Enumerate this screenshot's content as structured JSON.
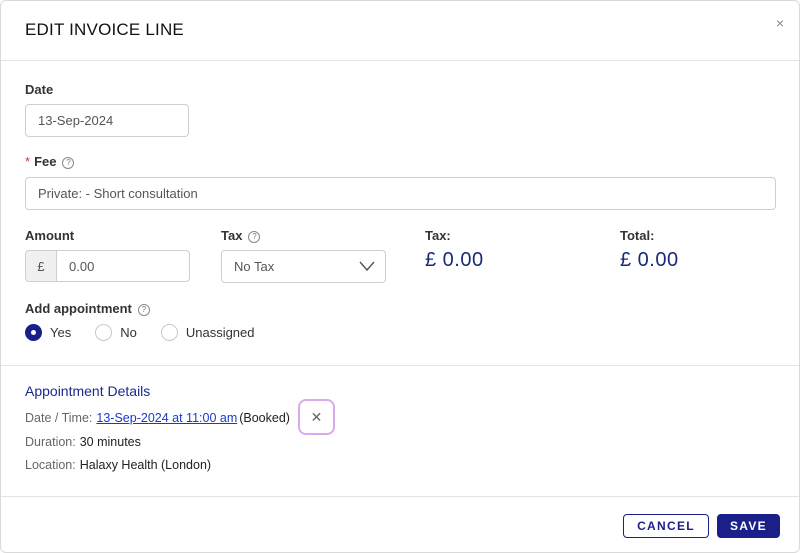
{
  "dialog": {
    "title": "EDIT INVOICE LINE",
    "close_icon": "×"
  },
  "date": {
    "label": "Date",
    "value": "13-Sep-2024"
  },
  "fee": {
    "required_mark": "*",
    "label": "Fee",
    "help_icon": "?",
    "value": "Private:  - Short consultation"
  },
  "amount": {
    "label": "Amount",
    "currency": "£",
    "value": "0.00"
  },
  "tax_select": {
    "label": "Tax",
    "help_icon": "?",
    "value": "No Tax"
  },
  "tax_total": {
    "label": "Tax:",
    "value": "£ 0.00"
  },
  "total": {
    "label": "Total:",
    "value": "£ 0.00"
  },
  "add_appointment": {
    "label": "Add appointment",
    "help_icon": "?",
    "options": [
      "Yes",
      "No",
      "Unassigned"
    ],
    "selected": "Yes"
  },
  "appointment": {
    "title": "Appointment Details",
    "datetime_label": "Date / Time:",
    "datetime_value": "13-Sep-2024 at 11:00 am",
    "status": "(Booked)",
    "unlink_icon": "✕",
    "duration_label": "Duration:",
    "duration_value": "30 minutes",
    "location_label": "Location:",
    "location_value": "Halaxy Health (London)"
  },
  "footer": {
    "cancel_label": "CANCEL",
    "save_label": "SAVE"
  },
  "colors": {
    "accent": "#1a1f8a",
    "link": "#1a3acc",
    "amount": "#1a2a78",
    "focus_ring": "#d9a9ee"
  }
}
